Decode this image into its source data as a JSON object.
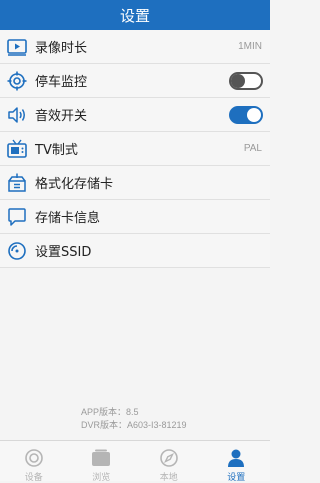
{
  "header": {
    "title": "设置"
  },
  "settings": [
    {
      "label": "录像时长",
      "value": "1MIN",
      "icon": "video-duration-icon"
    },
    {
      "label": "停车监控",
      "toggle": "off",
      "icon": "parking-target-icon"
    },
    {
      "label": "音效开关",
      "toggle": "on",
      "icon": "speaker-icon"
    },
    {
      "label": "TV制式",
      "value": "PAL",
      "icon": "tv-icon"
    },
    {
      "label": "格式化存储卡",
      "icon": "format-box-icon"
    },
    {
      "label": "存储卡信息",
      "icon": "card-info-icon"
    },
    {
      "label": "设置SSID",
      "icon": "ssid-icon"
    }
  ],
  "versions": {
    "app": "APP版本：8.5",
    "dvr": "DVR版本：A603-I3-81219"
  },
  "tabs": [
    {
      "label": "设备",
      "icon": "device-icon",
      "active": false
    },
    {
      "label": "浏览",
      "icon": "browse-icon",
      "active": false
    },
    {
      "label": "本地",
      "icon": "compass-icon",
      "active": false
    },
    {
      "label": "设置",
      "icon": "user-icon",
      "active": true
    }
  ],
  "colors": {
    "accent": "#1e6fbf",
    "muted": "#9a9a9a"
  }
}
